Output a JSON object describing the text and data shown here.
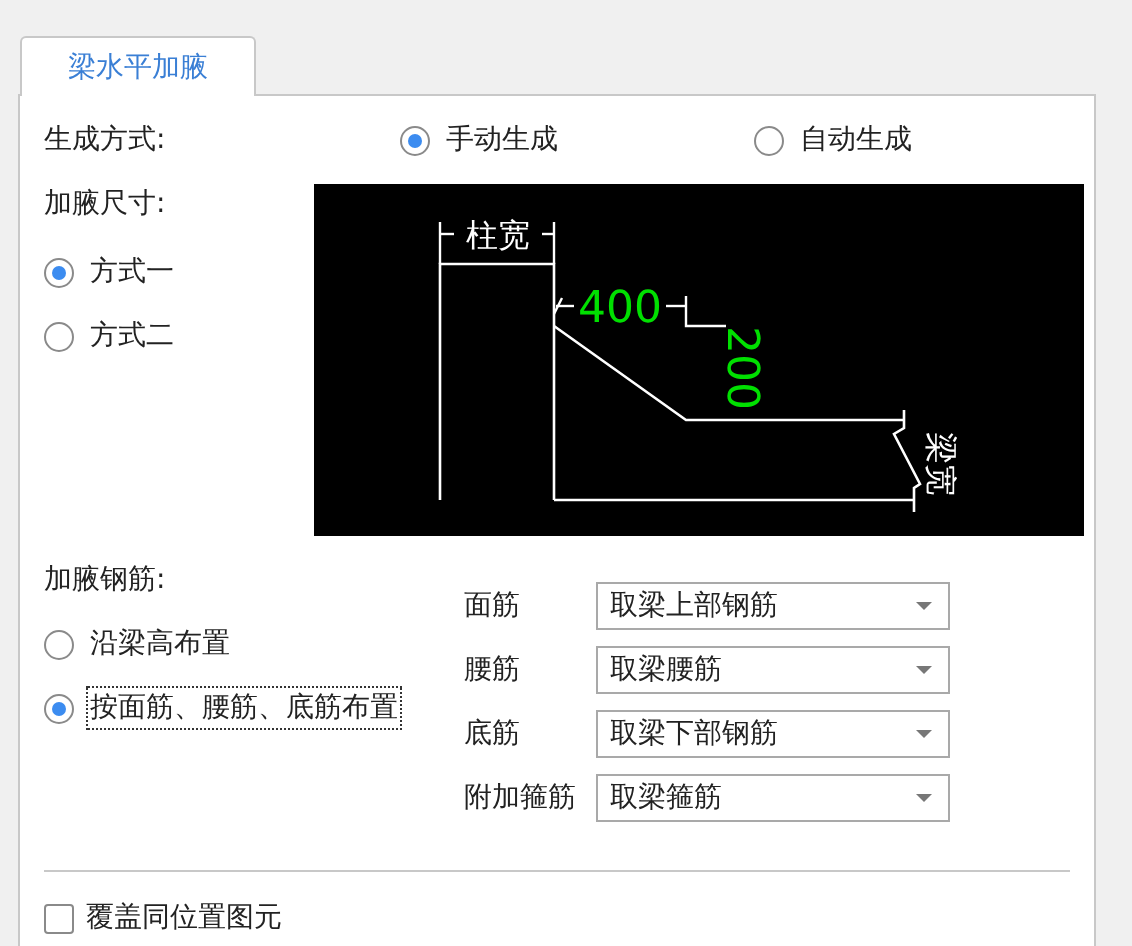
{
  "tabs": [
    {
      "label": "梁水平加腋",
      "selected": true
    }
  ],
  "generation": {
    "label": "生成方式:",
    "options": [
      {
        "label": "手动生成",
        "selected": true
      },
      {
        "label": "自动生成",
        "selected": false
      }
    ]
  },
  "size": {
    "label": "加腋尺寸:",
    "options": [
      {
        "label": "方式一",
        "selected": true
      },
      {
        "label": "方式二",
        "selected": false
      }
    ]
  },
  "diagram": {
    "column_width_label": "柱宽",
    "horizontal_dim": "400",
    "vertical_dim": "200",
    "beam_width_label": "梁宽"
  },
  "rebar": {
    "label": "加腋钢筋:",
    "options": [
      {
        "label": "沿梁高布置",
        "selected": false,
        "focused": false
      },
      {
        "label": "按面筋、腰筋、底筋布置",
        "selected": true,
        "focused": true
      }
    ],
    "fields": [
      {
        "label": "面筋",
        "value": "取梁上部钢筋"
      },
      {
        "label": "腰筋",
        "value": "取梁腰筋"
      },
      {
        "label": "底筋",
        "value": "取梁下部钢筋"
      },
      {
        "label": "附加箍筋",
        "value": "取梁箍筋"
      }
    ]
  },
  "overwrite": {
    "label": "覆盖同位置图元",
    "checked": false
  }
}
